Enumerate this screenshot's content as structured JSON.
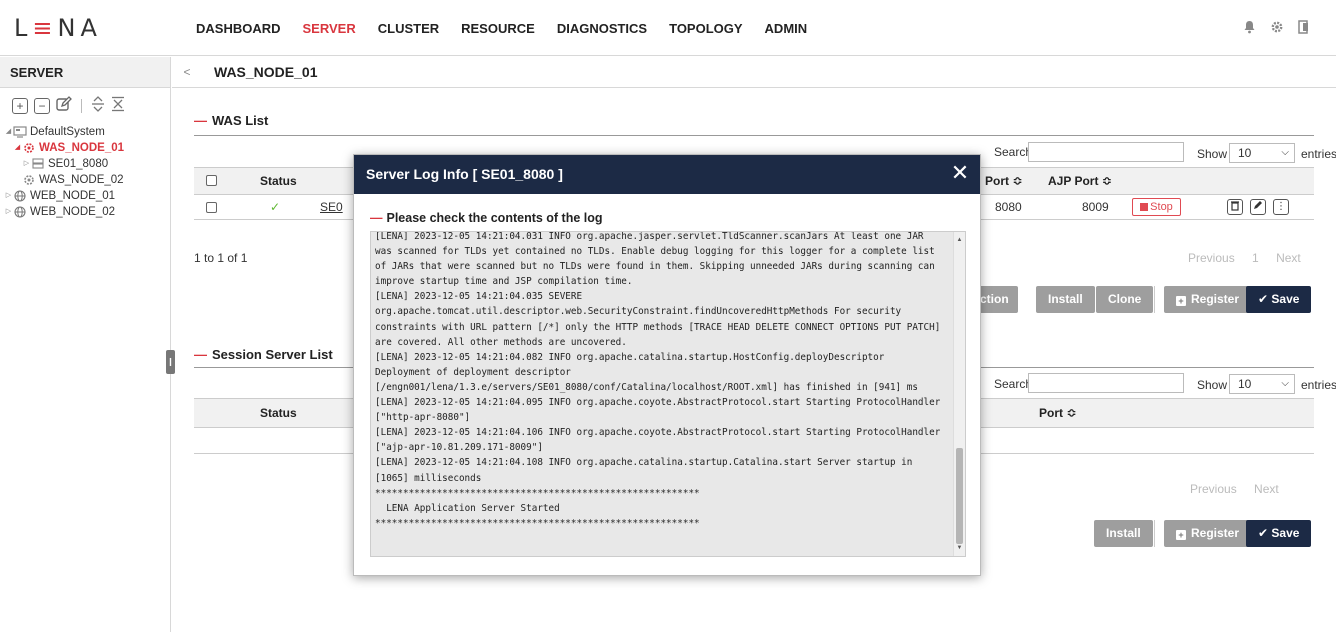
{
  "app": {
    "logo_text_a": "L",
    "logo_text_b": "NA"
  },
  "nav": {
    "items": [
      {
        "label": "DASHBOARD",
        "active": false
      },
      {
        "label": "SERVER",
        "active": true
      },
      {
        "label": "CLUSTER",
        "active": false
      },
      {
        "label": "RESOURCE",
        "active": false
      },
      {
        "label": "DIAGNOSTICS",
        "active": false
      },
      {
        "label": "TOPOLOGY",
        "active": false
      },
      {
        "label": "ADMIN",
        "active": false
      }
    ],
    "icons": [
      "bell-icon",
      "gear-icon",
      "logout-icon"
    ]
  },
  "sidebar": {
    "title": "SERVER",
    "tree": [
      {
        "label": "DefaultSystem",
        "icon": "system-icon",
        "toggle": "◢",
        "indent": 0,
        "selected": false
      },
      {
        "label": "WAS_NODE_01",
        "icon": "node-icon",
        "toggle": "◢",
        "indent": 1,
        "selected": true
      },
      {
        "label": "SE01_8080",
        "icon": "server-icon",
        "toggle": "▷",
        "indent": 2,
        "selected": false
      },
      {
        "label": "WAS_NODE_02",
        "icon": "node-icon",
        "toggle": "",
        "indent": 1,
        "selected": false
      },
      {
        "label": "WEB_NODE_01",
        "icon": "globe-icon",
        "toggle": "▷",
        "indent": 0,
        "selected": false
      },
      {
        "label": "WEB_NODE_02",
        "icon": "globe-icon",
        "toggle": "▷",
        "indent": 0,
        "selected": false
      }
    ]
  },
  "main": {
    "breadcrumb": "WAS_NODE_01",
    "was_list": {
      "title": "WAS List",
      "search_label": "Search",
      "show_label": "Show",
      "entries_label": "entries",
      "page_size": "10",
      "columns": {
        "status": "Status",
        "port": "Port ≎",
        "ajp_port": "AJP Port ≎"
      },
      "row": {
        "status_mark": "✓",
        "name_partial": "SE0",
        "port": "8080",
        "ajp_port": "8009",
        "stop_label": "Stop"
      },
      "info": "1 to 1 of 1",
      "paging": {
        "previous": "Previous",
        "page": "1",
        "next": "Next"
      },
      "buttons": {
        "action": "Action",
        "install": "Install",
        "clone": "Clone",
        "register": "Register",
        "save": "Save"
      }
    },
    "session_list": {
      "title": "Session Server List",
      "search_label": "Search",
      "show_label": "Show",
      "entries_label": "entries",
      "page_size": "10",
      "columns": {
        "status": "Status",
        "port": "Port ≎"
      },
      "paging": {
        "previous": "Previous",
        "next": "Next"
      },
      "buttons": {
        "install": "Install",
        "register": "Register",
        "save": "Save"
      }
    }
  },
  "modal": {
    "title": "Server Log Info [ SE01_8080 ]",
    "close_glyph": "✕",
    "subtitle": "Please check the contents of the log",
    "log": "[LENA] 2023-12-05 14:21:04.031 INFO org.apache.jasper.servlet.TldScanner.scanJars At least one JAR\nwas scanned for TLDs yet contained no TLDs. Enable debug logging for this logger for a complete list\nof JARs that were scanned but no TLDs were found in them. Skipping unneeded JARs during scanning can\nimprove startup time and JSP compilation time.\n[LENA] 2023-12-05 14:21:04.035 SEVERE\norg.apache.tomcat.util.descriptor.web.SecurityConstraint.findUncoveredHttpMethods For security\nconstraints with URL pattern [/*] only the HTTP methods [TRACE HEAD DELETE CONNECT OPTIONS PUT PATCH]\nare covered. All other methods are uncovered.\n[LENA] 2023-12-05 14:21:04.082 INFO org.apache.catalina.startup.HostConfig.deployDescriptor\nDeployment of deployment descriptor\n[/engn001/lena/1.3.e/servers/SE01_8080/conf/Catalina/localhost/ROOT.xml] has finished in [941] ms\n[LENA] 2023-12-05 14:21:04.095 INFO org.apache.coyote.AbstractProtocol.start Starting ProtocolHandler\n[\"http-apr-8080\"]\n[LENA] 2023-12-05 14:21:04.106 INFO org.apache.coyote.AbstractProtocol.start Starting ProtocolHandler\n[\"ajp-apr-10.81.209.171-8009\"]\n[LENA] 2023-12-05 14:21:04.108 INFO org.apache.catalina.startup.Catalina.start Server startup in\n[1065] milliseconds\n**********************************************************\n  LENA Application Server Started\n**********************************************************"
  },
  "colors": {
    "accent": "#d9363e",
    "navy": "#1c2a45",
    "gray_button": "#9e9e9e",
    "ok_green": "#5fb832"
  }
}
